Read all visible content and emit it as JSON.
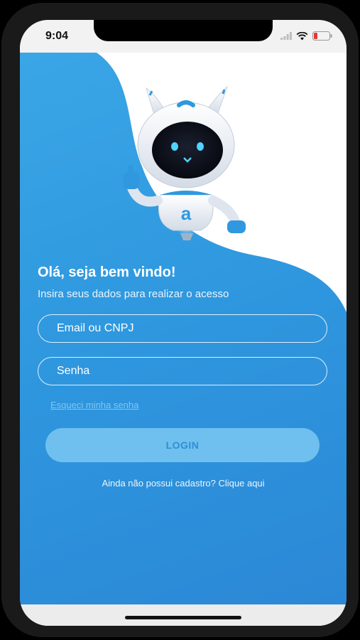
{
  "status_bar": {
    "time": "9:04"
  },
  "login_screen": {
    "title": "Olá, seja bem vindo!",
    "subtitle": "Insira seus dados para realizar o acesso",
    "email_placeholder": "Email ou CNPJ",
    "password_placeholder": "Senha",
    "forgot_password_link": "Esqueci minha senha",
    "login_button": "LOGIN",
    "signup_prompt": "Ainda não possui cadastro? Clique aqui",
    "mascot_letter": "a"
  },
  "colors": {
    "primary_blue": "#2f98df",
    "button_light_blue": "#6fc0ee",
    "link_blue": "#7ec6f2",
    "white": "#ffffff"
  }
}
